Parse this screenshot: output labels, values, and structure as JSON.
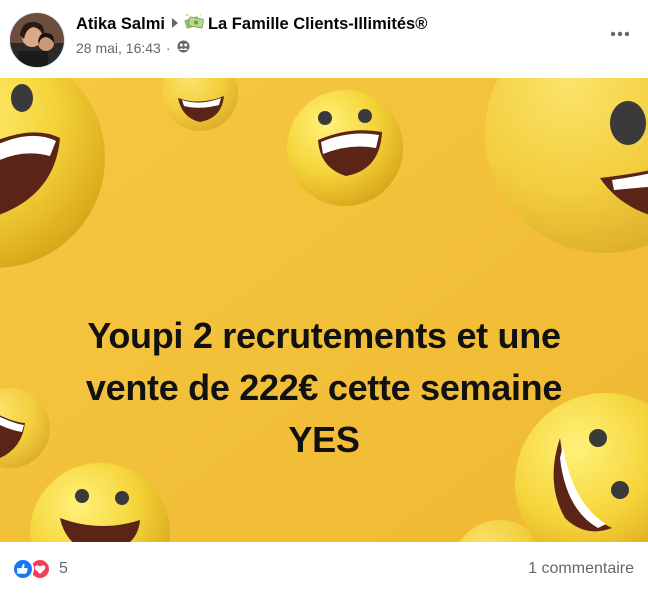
{
  "post": {
    "author": "Atika Salmi",
    "group": "La Famille Clients-Illimités®",
    "date": "28 mai, 16:43",
    "dot": "·"
  },
  "banner": {
    "line1": "Youpi 2 recrutements et une",
    "line2": "vente de 222€ cette semaine",
    "line3": "YES",
    "background_color": "#f5c33b"
  },
  "footer": {
    "reaction_count": "5",
    "comments": "1 commentaire"
  },
  "icons": {
    "more": "more-options-icon",
    "privacy": "group-members-icon",
    "arrow": "right-arrow-icon",
    "money": "money-icon",
    "like": "like-reaction-icon",
    "love": "love-reaction-icon"
  }
}
